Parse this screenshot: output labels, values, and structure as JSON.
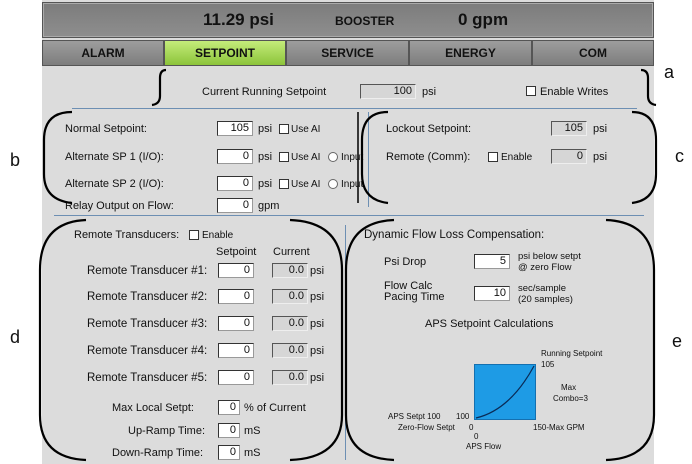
{
  "status": {
    "pressure": "11.29 psi",
    "mode": "BOOSTER",
    "flow": "0 gpm"
  },
  "tabs": [
    "ALARM",
    "SETPOINT",
    "SERVICE",
    "ENERGY",
    "COM"
  ],
  "running": {
    "label": "Current Running Setpoint",
    "value": "100",
    "unit": "psi",
    "enable": "Enable Writes"
  },
  "left": {
    "normal": {
      "label": "Normal Setpoint:",
      "value": "105",
      "unit": "psi",
      "useai": "Use AI"
    },
    "alt1": {
      "label": "Alternate SP 1 (I/O):",
      "value": "0",
      "unit": "psi",
      "useai": "Use AI",
      "input": "Input"
    },
    "alt2": {
      "label": "Alternate SP 2 (I/O):",
      "value": "0",
      "unit": "psi",
      "useai": "Use AI",
      "input": "Input"
    },
    "relay": {
      "label": "Relay Output on Flow:",
      "value": "0",
      "unit": "gpm"
    }
  },
  "right": {
    "lockout": {
      "label": "Lockout Setpoint:",
      "value": "105",
      "unit": "psi"
    },
    "remote": {
      "label": "Remote (Comm):",
      "enable": "Enable",
      "value": "0",
      "unit": "psi"
    }
  },
  "remote": {
    "title": "Remote Transducers:",
    "enable": "Enable",
    "col_setpoint": "Setpoint",
    "col_current": "Current",
    "rows": [
      {
        "label": "Remote Transducer #1:",
        "setpoint": "0",
        "current": "0.0",
        "unit": "psi"
      },
      {
        "label": "Remote Transducer #2:",
        "setpoint": "0",
        "current": "0.0",
        "unit": "psi"
      },
      {
        "label": "Remote Transducer #3:",
        "setpoint": "0",
        "current": "0.0",
        "unit": "psi"
      },
      {
        "label": "Remote Transducer #4:",
        "setpoint": "0",
        "current": "0.0",
        "unit": "psi"
      },
      {
        "label": "Remote Transducer #5:",
        "setpoint": "0",
        "current": "0.0",
        "unit": "psi"
      }
    ],
    "maxlocal": {
      "label": "Max Local Setpt:",
      "value": "0",
      "unit": "% of Current"
    },
    "upramp": {
      "label": "Up-Ramp Time:",
      "value": "0",
      "unit": "mS"
    },
    "downramp": {
      "label": "Down-Ramp Time:",
      "value": "0",
      "unit": "mS"
    }
  },
  "dflc": {
    "title": "Dynamic Flow Loss Compensation:",
    "psidrop": {
      "label": "Psi Drop",
      "value": "5",
      "note1": "psi below setpt",
      "note2": "@ zero Flow"
    },
    "pacing": {
      "label1": "Flow Calc",
      "label2": "Pacing Time",
      "value": "10",
      "note1": "sec/sample",
      "note2": "(20 samples)"
    },
    "calc_title": "APS Setpoint Calculations",
    "graph": {
      "running": "Running Setpoint",
      "rs_val": "105",
      "max1": "Max",
      "max2": "Combo=3",
      "aps": "APS Setpt 100",
      "aps_val": "100",
      "zero": "Zero-Flow Setpt",
      "zero_val": "0",
      "x0": "0",
      "maxgpm": "150-Max GPM",
      "xlabel": "APS Flow",
      "fill": "#1e9be5"
    }
  },
  "annotations": {
    "a": "a",
    "b": "b",
    "c": "c",
    "d": "d",
    "e": "e"
  }
}
